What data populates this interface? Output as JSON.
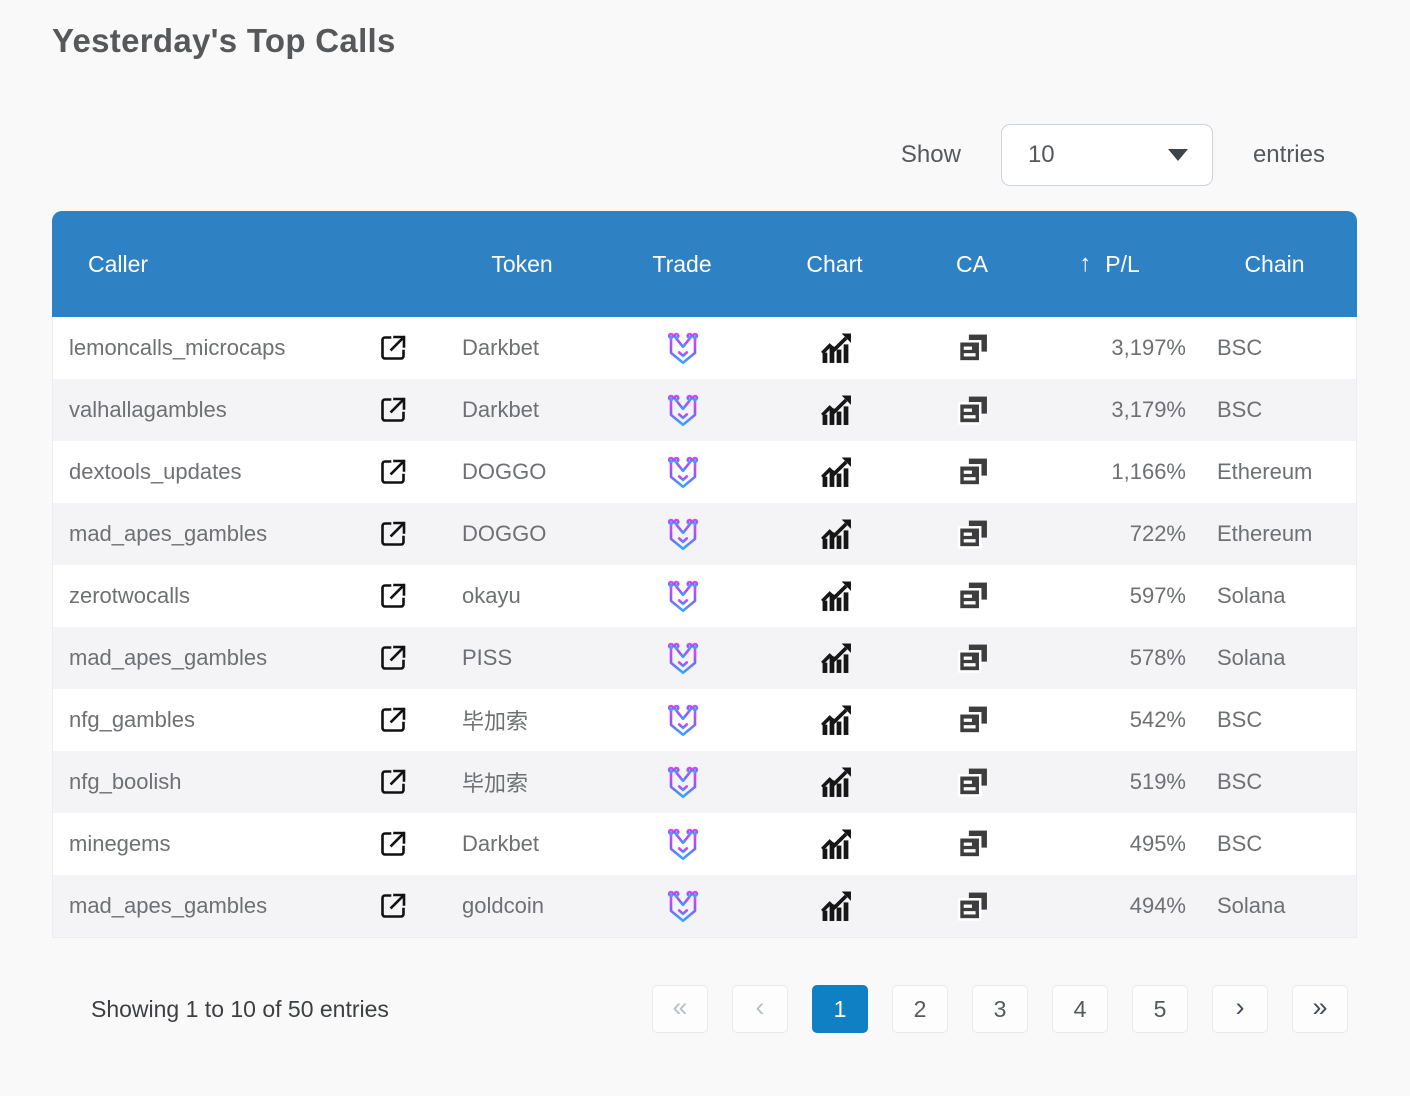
{
  "page": {
    "title": "Yesterday's Top Calls"
  },
  "controls": {
    "show_label": "Show",
    "entries_label": "entries",
    "page_size": "10"
  },
  "table": {
    "headers": [
      "Caller",
      "Token",
      "Trade",
      "Chart",
      "CA",
      "P/L",
      "Chain"
    ],
    "sort_icon": "↑",
    "rows": [
      {
        "caller": "lemoncalls_microcaps",
        "token": "Darkbet",
        "pl": "3,197%",
        "chain": "BSC"
      },
      {
        "caller": "valhallagambles",
        "token": "Darkbet",
        "pl": "3,179%",
        "chain": "BSC"
      },
      {
        "caller": "dextools_updates",
        "token": "DOGGO",
        "pl": "1,166%",
        "chain": "Ethereum"
      },
      {
        "caller": "mad_apes_gambles",
        "token": "DOGGO",
        "pl": "722%",
        "chain": "Ethereum"
      },
      {
        "caller": "zerotwocalls",
        "token": "okayu",
        "pl": "597%",
        "chain": "Solana"
      },
      {
        "caller": "mad_apes_gambles",
        "token": "PISS",
        "pl": "578%",
        "chain": "Solana"
      },
      {
        "caller": "nfg_gambles",
        "token": "毕加索",
        "pl": "542%",
        "chain": "BSC"
      },
      {
        "caller": "nfg_boolish",
        "token": "毕加索",
        "pl": "519%",
        "chain": "BSC"
      },
      {
        "caller": "minegems",
        "token": "Darkbet",
        "pl": "495%",
        "chain": "BSC"
      },
      {
        "caller": "mad_apes_gambles",
        "token": "goldcoin",
        "pl": "494%",
        "chain": "Solana"
      }
    ],
    "row_icons": {
      "caller_link": "external-link",
      "trade": "maestro-bot-logo",
      "chart": "trending-up-chart",
      "ca": "copy-contract"
    }
  },
  "pagination": {
    "summary": "Showing 1 to 10 of 50 entries",
    "first_label": "«",
    "prev_label": "‹",
    "pages": [
      "1",
      "2",
      "3",
      "4",
      "5"
    ],
    "active_page": "1",
    "next_label": "›",
    "last_label": "»"
  },
  "colors": {
    "header_bg": "#2e82c4",
    "active_page_bg": "#1080c5",
    "row_alt_bg": "#f4f4f6",
    "logo_magenta": "#cf3df0",
    "logo_blue": "#35a7ff"
  }
}
